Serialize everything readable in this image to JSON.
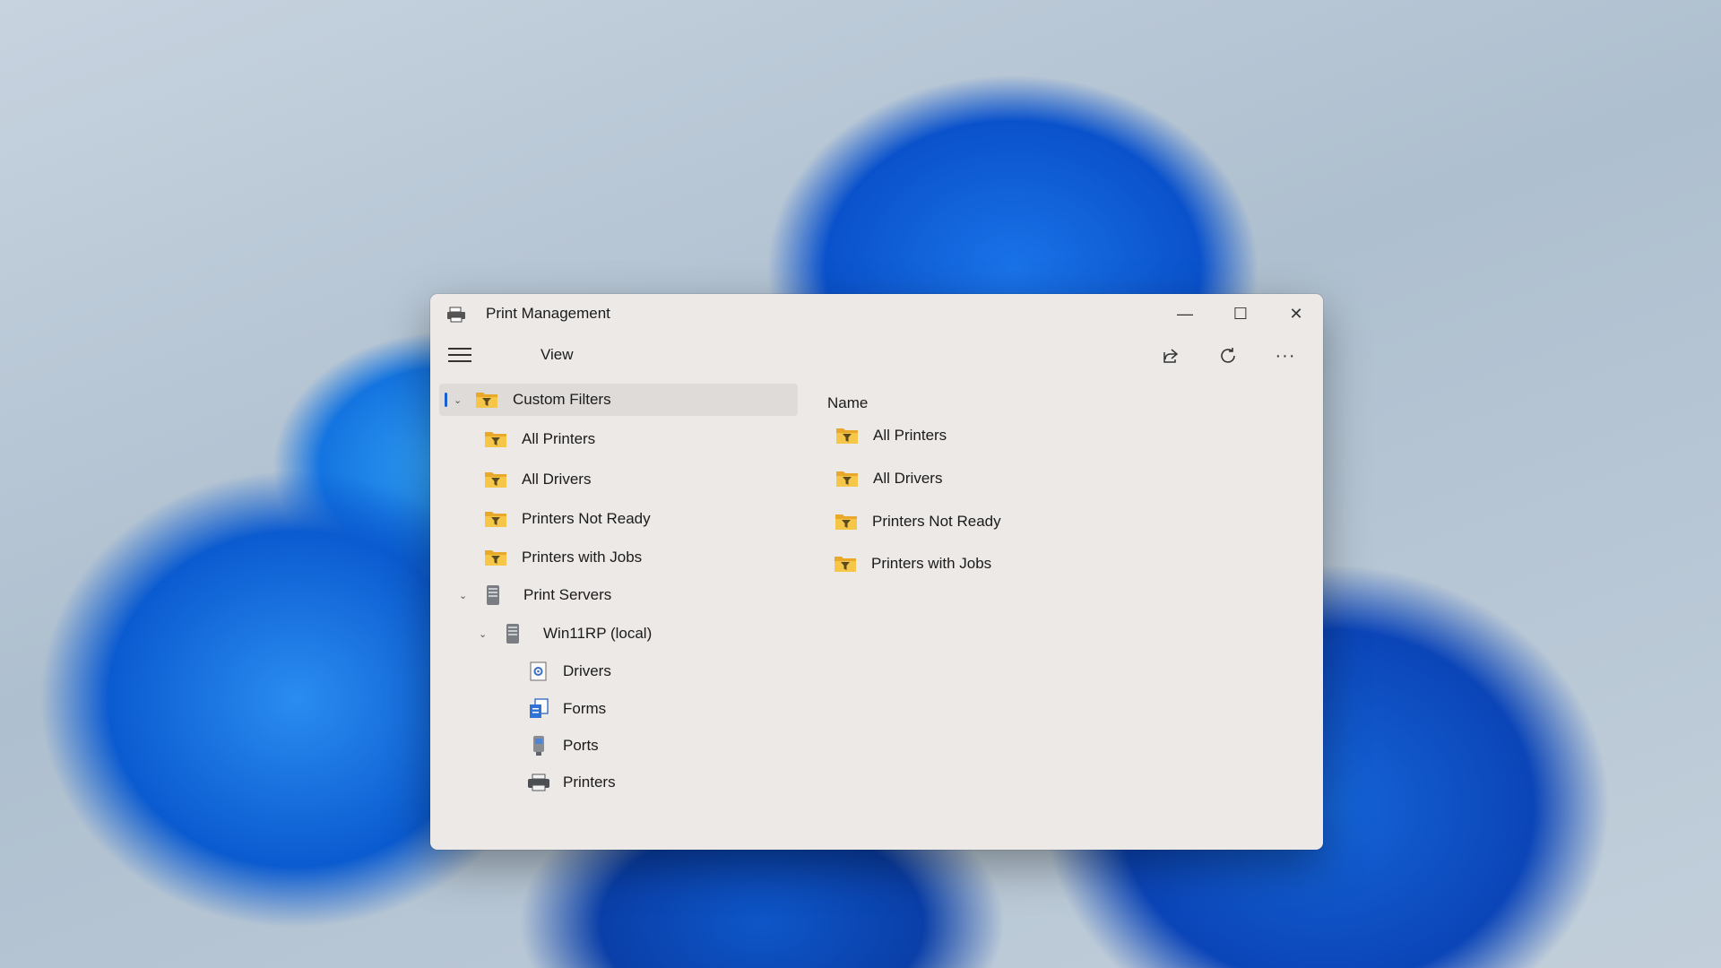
{
  "window": {
    "title": "Print Management",
    "controls": {
      "minimize": "—",
      "maximize": "☐",
      "close": "✕"
    }
  },
  "menubar": {
    "menu_icon": "hamburger-icon",
    "view_label": "View",
    "share_icon": "share-icon",
    "refresh_icon": "refresh-icon",
    "more_label": "···"
  },
  "tree": {
    "custom_filters": "Custom Filters",
    "filter_items": [
      "All Printers",
      "All Drivers",
      "Printers Not Ready",
      "Printers with Jobs"
    ],
    "print_servers": "Print Servers",
    "server": "Win11RP (local)",
    "server_items": [
      "Drivers",
      "Forms",
      "Ports",
      "Printers"
    ]
  },
  "content": {
    "column_header": "Name",
    "items": [
      "All Printers",
      "All Drivers",
      "Printers Not Ready",
      "Printers with Jobs"
    ]
  },
  "colors": {
    "accent": "#1a5fd0",
    "window_bg": "#ece9e7",
    "folder_yellow": "#f6c649"
  }
}
